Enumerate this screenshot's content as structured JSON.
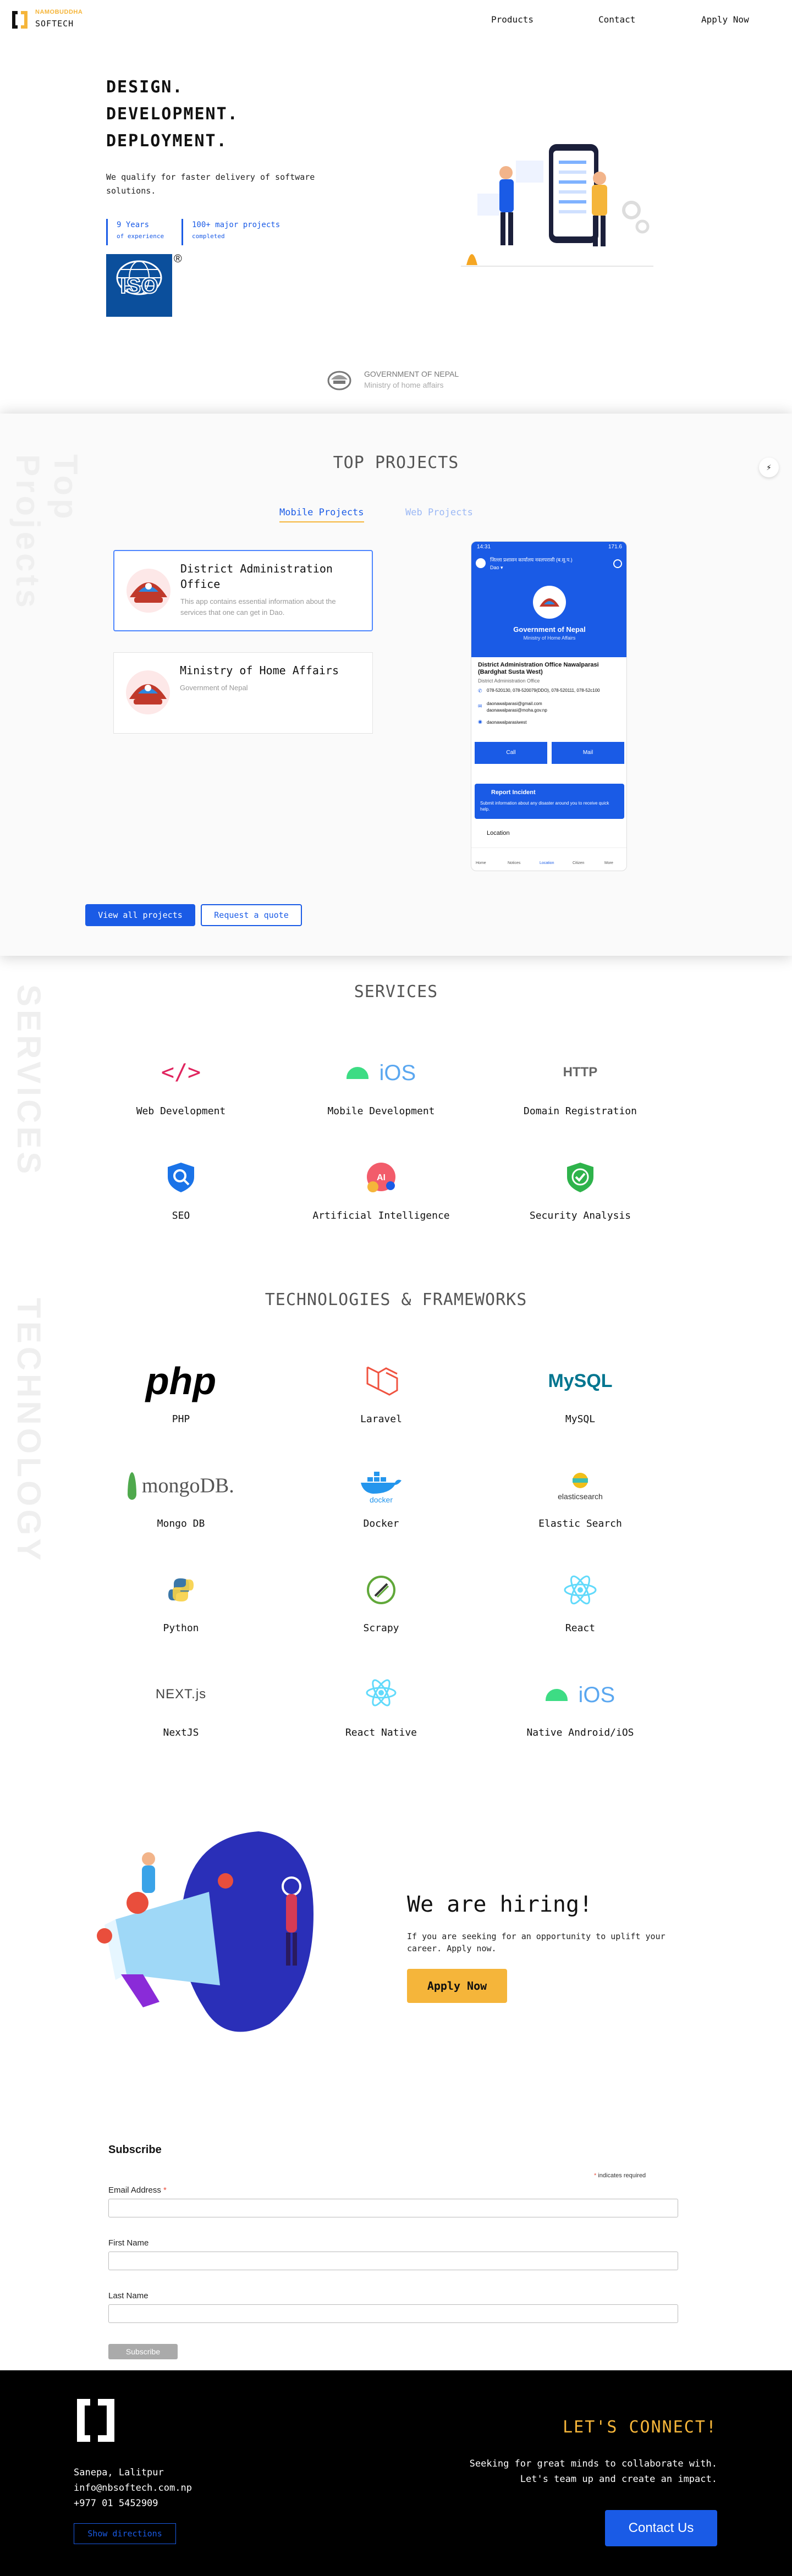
{
  "header": {
    "logo_top": "NAMOBUDDHA",
    "logo_bottom": "SOFTECH",
    "nav": [
      "Products",
      "Contact",
      "Apply Now"
    ]
  },
  "hero": {
    "lines": [
      "DESIGN.",
      "DEVELOPMENT.",
      "DEPLOYMENT."
    ],
    "subtitle": "We qualify for faster delivery of software solutions.",
    "stats": [
      {
        "value": "9 Years",
        "label": "of experience"
      },
      {
        "value": "100+ major projects",
        "label": "completed"
      }
    ],
    "iso_text": "ISO",
    "iso_mark": "®"
  },
  "govt": {
    "title": "GOVERNMENT OF NEPAL",
    "subtitle": "Ministry of home affairs"
  },
  "projects": {
    "watermark": "Top Projects",
    "title": "TOP PROJECTS",
    "tabs": [
      "Mobile Projects",
      "Web Projects"
    ],
    "cards": [
      {
        "name": "District Administration Office",
        "desc": "This app contains essential information about the services that one can get in Dao."
      },
      {
        "name": "Ministry of Home Affairs",
        "desc": "Government of Nepal"
      }
    ],
    "buttons": {
      "view_all": "View all projects",
      "quote": "Request a quote"
    },
    "phone": {
      "time": "14:31",
      "status": "171.6",
      "app_header": "जिल्ला प्रशासन कार्यालय नवलपरासी (ब.सु.प.)",
      "app_header_sub": "Dao ▾",
      "banner_line1": "Government of Nepal",
      "banner_line2": "Ministry of Home Affairs",
      "office_name": "District Administration Office Nawalparasi (Bardghat Susta West)",
      "office_sub": "District Administration Office",
      "phone_line": "078-520130, 078-520079(DDO), 078-520111, 078-52c100",
      "email_line1": "daonawalparasi@gmail.com",
      "email_line2": "daonawalparasi@moha.gov.np",
      "web_line": "daonawalparasiwest",
      "call_label": "Call",
      "mail_label": "Mail",
      "incident_title": "Report Incident",
      "incident_desc": "Submit information about any disaster around you to receive quick help.",
      "location_label": "Location",
      "bottom_nav": [
        "Home",
        "Notices",
        "Location",
        "Citizen",
        "More"
      ]
    }
  },
  "services": {
    "watermark": "SERVICES",
    "title": "SERVICES",
    "items": [
      {
        "label": "Web Development",
        "icon": "code-icon",
        "glyph": "</>"
      },
      {
        "label": "Mobile Development",
        "icon": "android-ios-icon",
        "glyph": "iOS"
      },
      {
        "label": "Domain Registration",
        "icon": "http-icon",
        "glyph": "HTTP"
      },
      {
        "label": "SEO",
        "icon": "seo-search-icon",
        "glyph": ""
      },
      {
        "label": "Artificial Intelligence",
        "icon": "ai-brain-icon",
        "glyph": "AI"
      },
      {
        "label": "Security Analysis",
        "icon": "shield-check-icon",
        "glyph": ""
      }
    ]
  },
  "tech": {
    "watermark": "TECHNOLOGY",
    "title": "TECHNOLOGIES & FRAMEWORKS",
    "items": [
      {
        "label": "PHP",
        "icon": "php-logo-icon",
        "glyph": "php"
      },
      {
        "label": "Laravel",
        "icon": "laravel-logo-icon",
        "glyph": ""
      },
      {
        "label": "MySQL",
        "icon": "mysql-logo-icon",
        "glyph": "MySQL"
      },
      {
        "label": "Mongo DB",
        "icon": "mongodb-logo-icon",
        "glyph": "mongoDB."
      },
      {
        "label": "Docker",
        "icon": "docker-logo-icon",
        "glyph": "docker"
      },
      {
        "label": "Elastic Search",
        "icon": "elasticsearch-logo-icon",
        "glyph": "elasticsearch"
      },
      {
        "label": "Python",
        "icon": "python-logo-icon",
        "glyph": ""
      },
      {
        "label": "Scrapy",
        "icon": "scrapy-logo-icon",
        "glyph": ""
      },
      {
        "label": "React",
        "icon": "react-logo-icon",
        "glyph": ""
      },
      {
        "label": "NextJS",
        "icon": "nextjs-logo-icon",
        "glyph": "NEXT.js"
      },
      {
        "label": "React Native",
        "icon": "react-native-logo-icon",
        "glyph": ""
      },
      {
        "label": "Native Android/iOS",
        "icon": "android-ios-icon",
        "glyph": "iOS"
      }
    ]
  },
  "hiring": {
    "title": "We are hiring!",
    "text": "If you are seeking for an opportunity to uplift your career. Apply now.",
    "button": "Apply Now"
  },
  "subscribe": {
    "title": "Subscribe",
    "required_note": "indicates required",
    "required_star": "*",
    "fields": [
      {
        "label": "Email Address",
        "required": true
      },
      {
        "label": "First Name",
        "required": false
      },
      {
        "label": "Last Name",
        "required": false
      }
    ],
    "button": "Subscribe"
  },
  "footer": {
    "address": "Sanepa, Lalitpur",
    "email": "info@nbsoftech.com.np",
    "phone": "+977 01 5452909",
    "directions": "Show directions",
    "connect_title": "LET'S CONNECT!",
    "connect_text_1": "Seeking for great minds to collaborate with.",
    "connect_text_2": "Let's team up and create an impact.",
    "contact_button": "Contact Us"
  },
  "colors": {
    "accent_blue": "#1a5be6",
    "brand_yellow": "#f5b53a",
    "footer_bg": "#000000"
  }
}
